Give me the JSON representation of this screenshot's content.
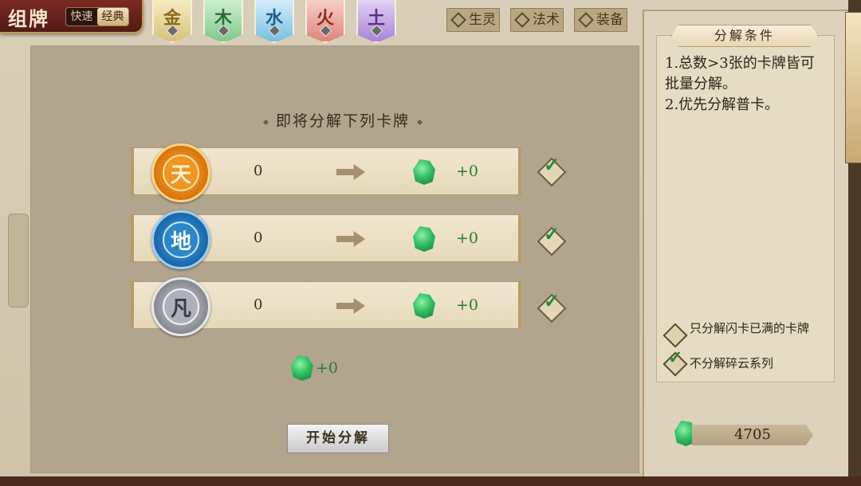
{
  "title": "组牌",
  "mode": {
    "fast": "快速",
    "classic": "经典"
  },
  "element_tabs": [
    "金",
    "木",
    "水",
    "火",
    "土"
  ],
  "type_tabs": [
    "生灵",
    "法术",
    "装备"
  ],
  "section_title": "即将分解下列卡牌",
  "rows": [
    {
      "rank": "天",
      "count": "0",
      "gain": "+0",
      "checked": true
    },
    {
      "rank": "地",
      "count": "0",
      "gain": "+0",
      "checked": true
    },
    {
      "rank": "凡",
      "count": "0",
      "gain": "+0",
      "checked": true
    }
  ],
  "total_gain": "+0",
  "start_button": "开始分解",
  "conditions": {
    "header": "分解条件",
    "text": [
      "1.总数>3张的卡牌皆可批量分解。",
      "2.优先分解普卡。"
    ],
    "options": [
      {
        "label": "只分解闪卡已满的卡牌",
        "checked": false
      },
      {
        "label": "不分解碎云系列",
        "checked": true
      }
    ]
  },
  "currency": "4705",
  "icons": [
    "jade-gem-icon",
    "arrow-icon",
    "check-icon"
  ]
}
